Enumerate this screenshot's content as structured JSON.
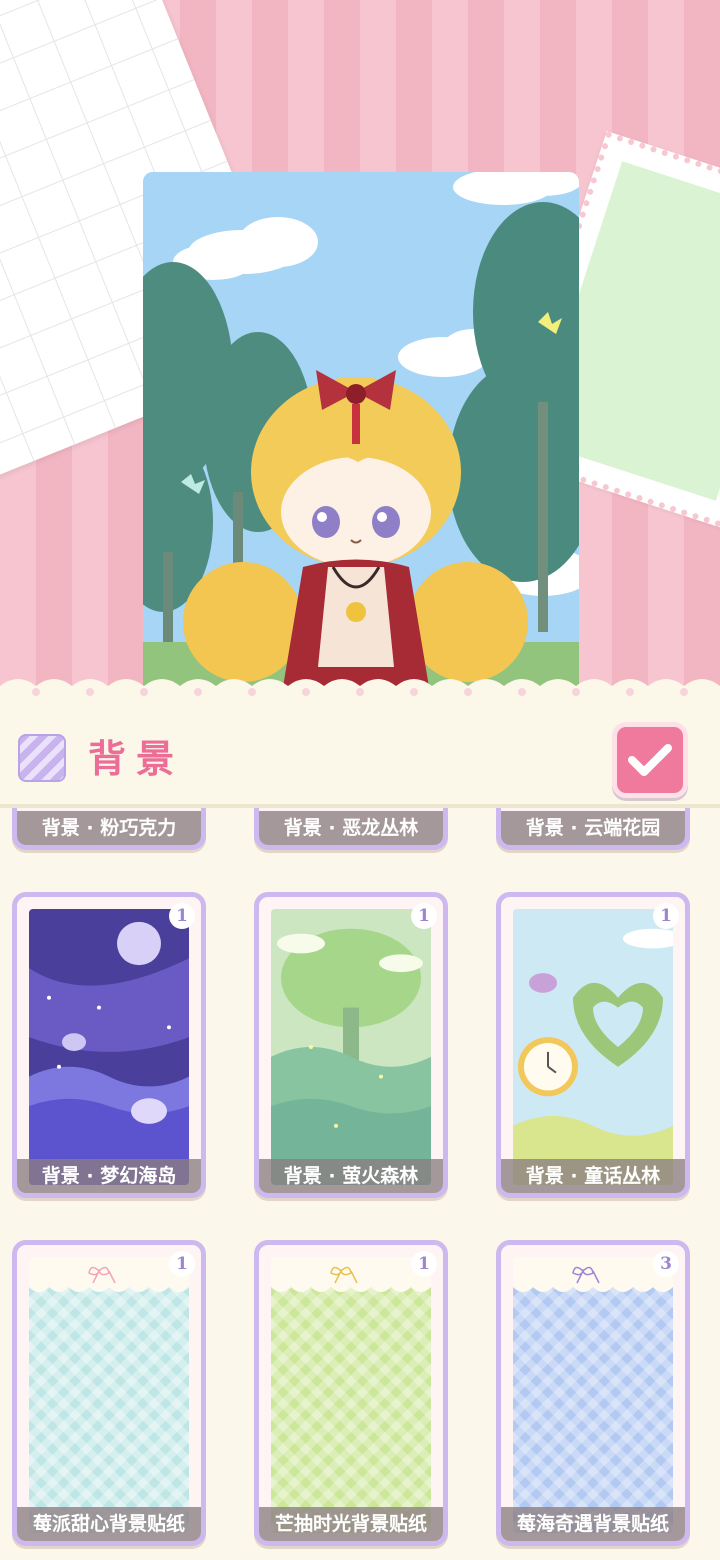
{
  "header": {
    "title": "背景",
    "confirm_icon": "check-icon"
  },
  "colors": {
    "accent_pink": "#f07a9e",
    "title_pink": "#ec6e98",
    "card_border": "#cdb8ef"
  },
  "cards_partial": [
    {
      "label": "背景 · 粉巧克力"
    },
    {
      "label": "背景 · 恶龙丛林"
    },
    {
      "label": "背景 · 云端花园"
    }
  ],
  "cards_row1": [
    {
      "label": "背景 · 梦幻海岛",
      "count": "1"
    },
    {
      "label": "背景 · 萤火森林",
      "count": "1"
    },
    {
      "label": "背景 · 童话丛林",
      "count": "1"
    }
  ],
  "cards_row2": [
    {
      "label": "莓派甜心背景贴纸",
      "count": "1"
    },
    {
      "label": "芒抽时光背景贴纸",
      "count": "1"
    },
    {
      "label": "莓海奇遇背景贴纸",
      "count": "3"
    }
  ]
}
